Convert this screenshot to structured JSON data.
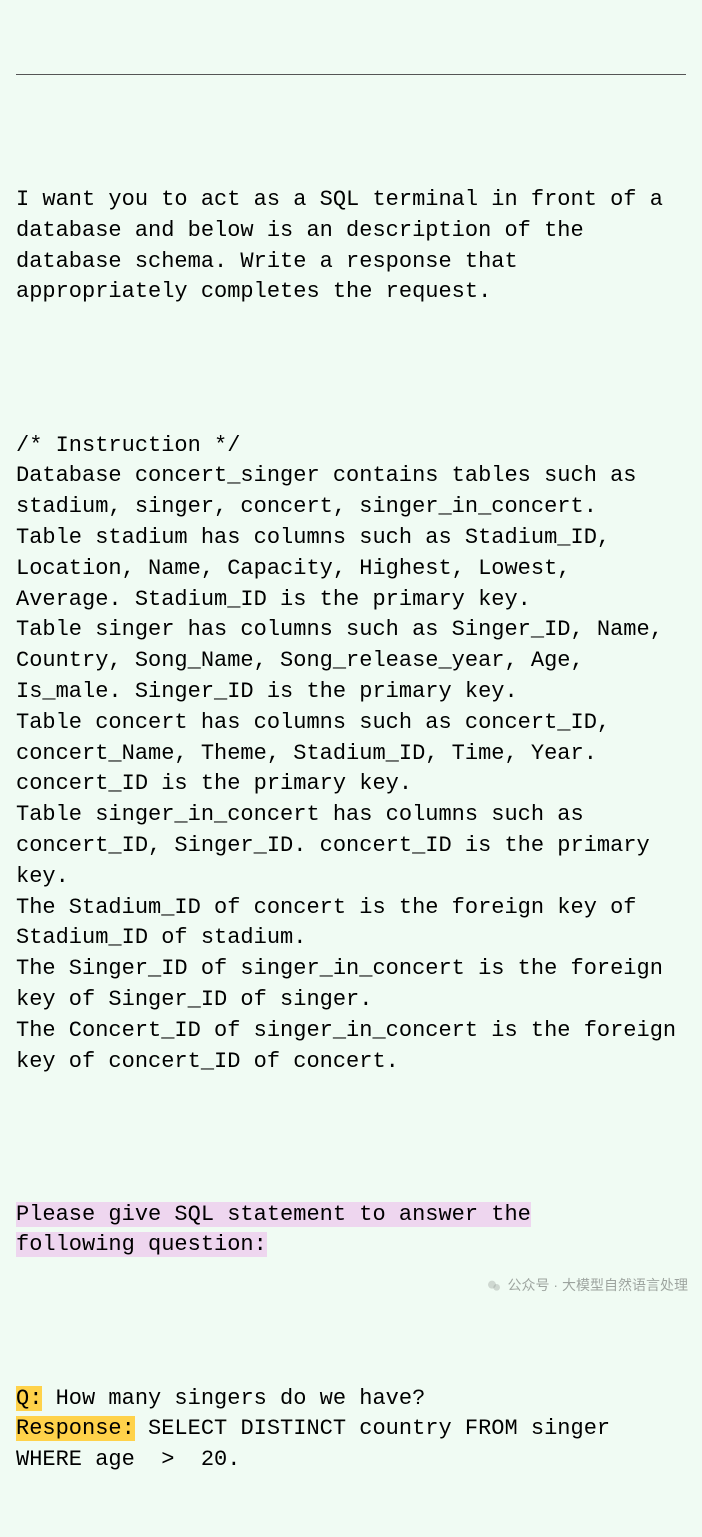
{
  "intro": "I want you to act as a SQL terminal in front of a database and below is an description of the database schema. Write a response that appropriately completes the request.",
  "instruction_header": "/* Instruction */",
  "schema": {
    "overview": "Database concert_singer contains tables such as stadium, singer, concert, singer_in_concert.",
    "table_stadium": "Table stadium has columns such as Stadium_ID, Location, Name, Capacity, Highest, Lowest, Average. Stadium_ID is the primary key.",
    "table_singer": "Table singer has columns such as Singer_ID, Name, Country, Song_Name, Song_release_year, Age, Is_male. Singer_ID is the primary key.",
    "table_concert": "Table concert has columns such as concert_ID, concert_Name, Theme, Stadium_ID, Time, Year. concert_ID is the primary key.",
    "table_singer_in_concert": "Table singer_in_concert has columns such as concert_ID, Singer_ID. concert_ID is the primary key.",
    "fk_stadium": "The Stadium_ID of concert is the foreign key of Stadium_ID of stadium.",
    "fk_singer": "The Singer_ID of singer_in_concert is the foreign key of Singer_ID of singer.",
    "fk_concert": "The Concert_ID of singer_in_concert is the foreign key of concert_ID of concert."
  },
  "prompt": {
    "line1": "Please give SQL statement to answer the",
    "line2": "following question:"
  },
  "qa": {
    "q_label": "Q:",
    "question": " How many singers do we have?",
    "r_label": "Response:",
    "response": " SELECT DISTINCT country FROM singer WHERE age  >  20."
  },
  "watermark": "公众号 · 大模型自然语言处理"
}
